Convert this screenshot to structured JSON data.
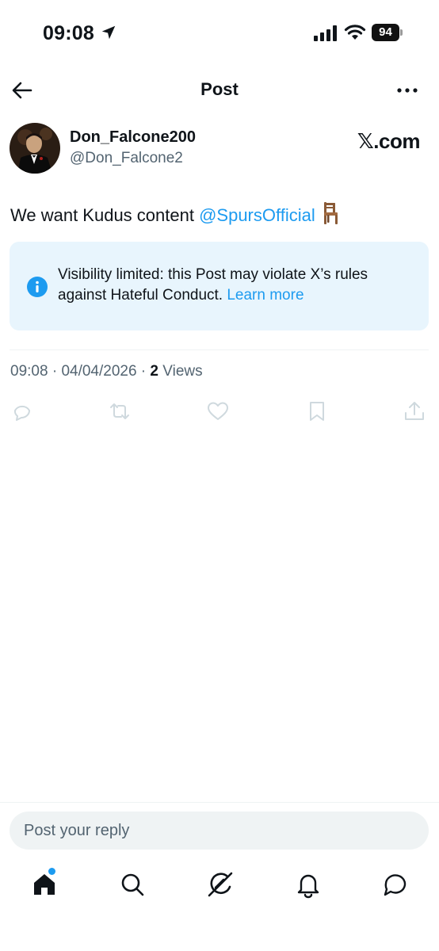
{
  "status_bar": {
    "time": "09:08",
    "battery": "94"
  },
  "header": {
    "title": "Post"
  },
  "post": {
    "author_name": "Don_Falcone200",
    "author_handle": "@Don_Falcone2",
    "source_badge": "𝕏.com",
    "text_before": "We want Kudus content ",
    "mention": "@SpursOfficial",
    "emoji_icon": "chair-icon",
    "notice": {
      "text": "Visibility limited: this Post may violate X’s rules against Hateful Conduct.",
      "link": "Learn more"
    },
    "time": "09:08",
    "date": "04/04/2026",
    "view_count": "2",
    "views_label": "Views"
  },
  "reply": {
    "placeholder": "Post your reply"
  },
  "tabs": [
    {
      "icon": "home-icon"
    },
    {
      "icon": "search-icon"
    },
    {
      "icon": "grok-icon"
    },
    {
      "icon": "bell-icon"
    },
    {
      "icon": "messages-icon"
    }
  ],
  "colors": {
    "accent": "#1d9bf0",
    "notice_bg": "#e8f5fd",
    "muted_text": "#536471",
    "action_icons": "#cfd9de"
  }
}
